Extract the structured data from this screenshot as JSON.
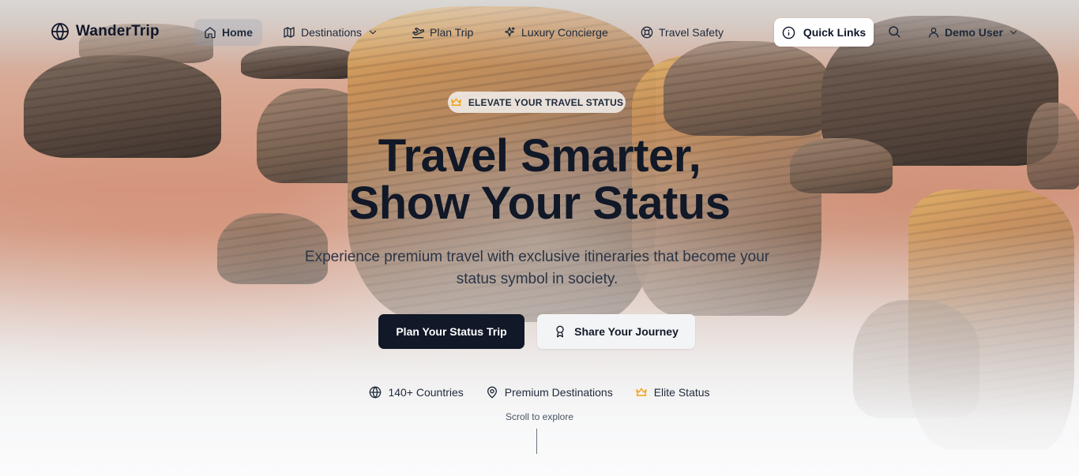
{
  "brand": {
    "name": "WanderTrip"
  },
  "nav": {
    "items": [
      {
        "label": "Home",
        "icon": "home-icon",
        "active": true
      },
      {
        "label": "Destinations",
        "icon": "map-icon",
        "dropdown": true
      },
      {
        "label": "Plan Trip",
        "icon": "plane-icon"
      },
      {
        "label": "Luxury Concierge",
        "icon": "sparkle-icon"
      },
      {
        "label": "Travel Safety",
        "icon": "lifebuoy-icon"
      }
    ],
    "quick_links": "Quick Links",
    "user": "Demo User"
  },
  "hero": {
    "badge": "ELEVATE YOUR TRAVEL STATUS",
    "headline_line1": "Travel Smarter,",
    "headline_line2": "Show Your Status",
    "subtitle": "Experience premium travel with exclusive itineraries that become your status symbol in society.",
    "primary_cta": "Plan Your Status Trip",
    "secondary_cta": "Share Your Journey"
  },
  "features": [
    {
      "label": "140+ Countries",
      "icon": "globe-icon"
    },
    {
      "label": "Premium Destinations",
      "icon": "map-pin-icon"
    },
    {
      "label": "Elite Status",
      "icon": "crown-icon"
    }
  ],
  "scroll_hint": "Scroll to explore",
  "colors": {
    "primary_dark": "#111827",
    "accent_gold": "#f59e0b",
    "nav_active_bg": "#cbd5e1"
  }
}
